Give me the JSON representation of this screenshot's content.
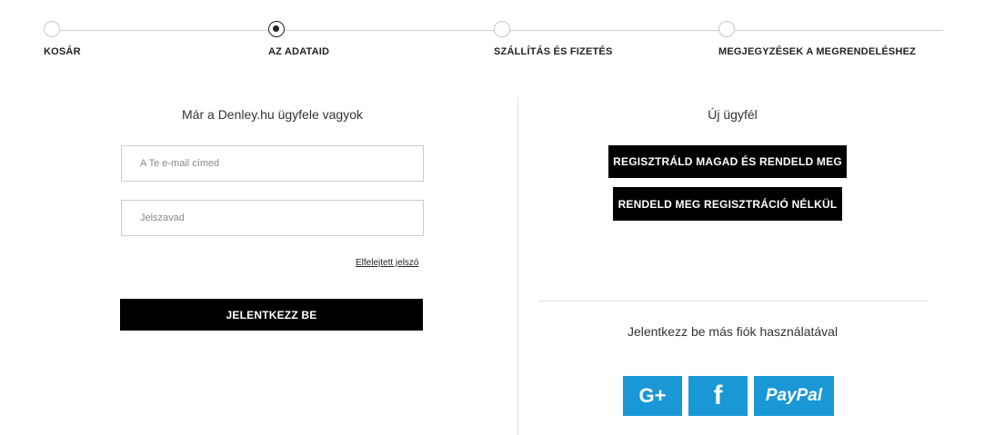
{
  "steps": [
    {
      "label": "KOSÁR",
      "active": false
    },
    {
      "label": "AZ ADATAID",
      "active": true
    },
    {
      "label": "SZÁLLÍTÁS ÉS FIZETÉS",
      "active": false
    },
    {
      "label": "MEGJEGYZÉSEK A MEGRENDELÉSHEZ",
      "active": false
    }
  ],
  "login": {
    "heading": "Már a Denley.hu ügyfele vagyok",
    "email_placeholder": "A Te e-mail címed",
    "email_value": "",
    "password_placeholder": "Jelszavad",
    "password_value": "",
    "forgot_label": "Elfelejtett jelszó",
    "submit_label": "JELENTKEZZ BE"
  },
  "new_customer": {
    "heading": "Új ügyfél",
    "register_label": "REGISZTRÁLD MAGAD ÉS RENDELD MEG",
    "guest_label": "RENDELD MEG REGISZTRÁCIÓ NÉLKÜL"
  },
  "social_login": {
    "heading": "Jelentkezz be más fiók használatával",
    "google_label": "G+",
    "facebook_label": "f",
    "paypal_label": "PayPal",
    "button_color": "#1a97d5"
  }
}
